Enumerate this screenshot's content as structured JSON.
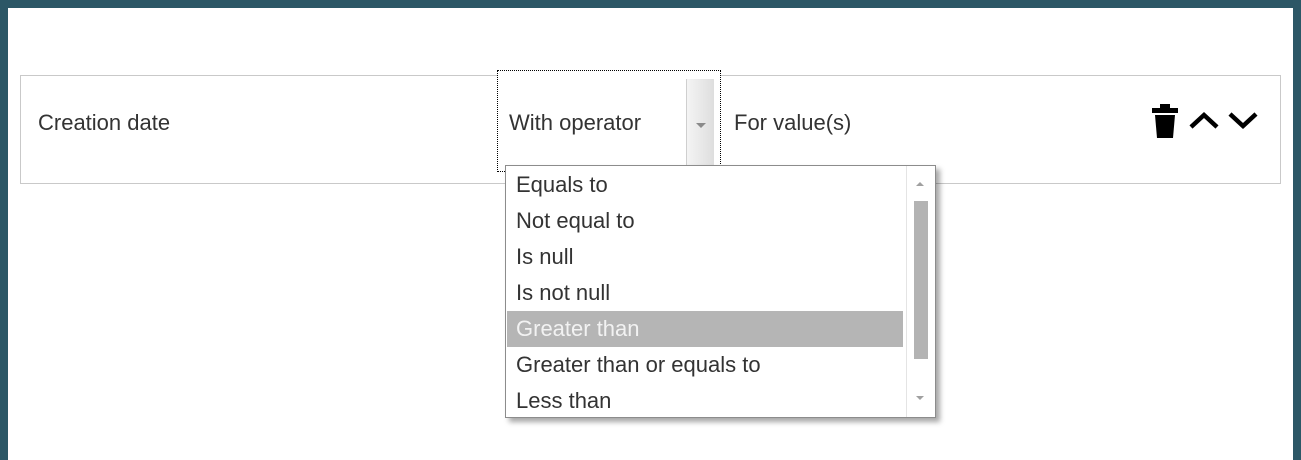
{
  "filter_row": {
    "field_label": "Creation date",
    "operator_value": "With operator",
    "value_label": "For value(s)"
  },
  "actions": {
    "delete_icon": "trash-icon",
    "move_up_icon": "chevron-up-icon",
    "move_down_icon": "chevron-down-icon"
  },
  "operator_dropdown": {
    "options": [
      "Equals to",
      "Not equal to",
      "Is null",
      "Is not null",
      "Greater than",
      "Greater than or equals to",
      "Less than"
    ],
    "highlighted_option": "Greater than"
  },
  "colors": {
    "frame_border": "#2c5766",
    "highlight": "#b5b5b5"
  }
}
